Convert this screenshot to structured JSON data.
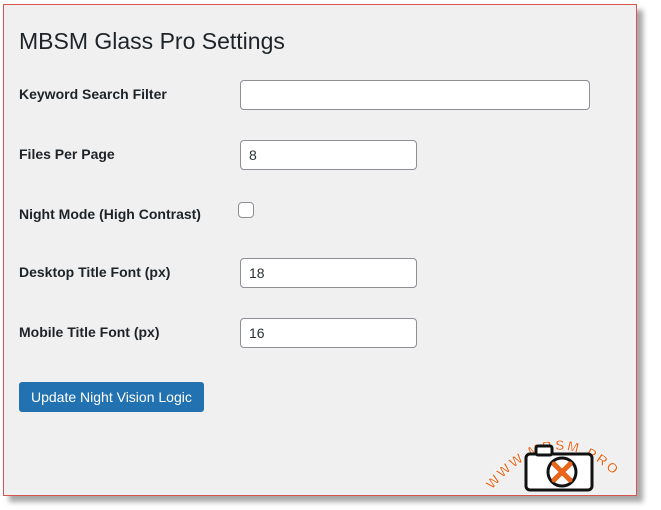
{
  "page": {
    "title": "MBSM Glass Pro Settings"
  },
  "settings": {
    "keyword_filter": {
      "label": "Keyword Search Filter",
      "value": ""
    },
    "files_per_page": {
      "label": "Files Per Page",
      "value": "8"
    },
    "night_mode": {
      "label": "Night Mode (High Contrast)",
      "checked": false
    },
    "desktop_title_font": {
      "label": "Desktop Title Font (px)",
      "value": "18"
    },
    "mobile_title_font": {
      "label": "Mobile Title Font (px)",
      "value": "16"
    }
  },
  "submit": {
    "label": "Update Night Vision Logic"
  },
  "watermark": {
    "text": "WWW.MBSM.PRO"
  },
  "colors": {
    "accent": "#2271b1",
    "background": "#f0f0f1",
    "border_frame": "#d9534f",
    "watermark_orange": "#e8641b"
  }
}
